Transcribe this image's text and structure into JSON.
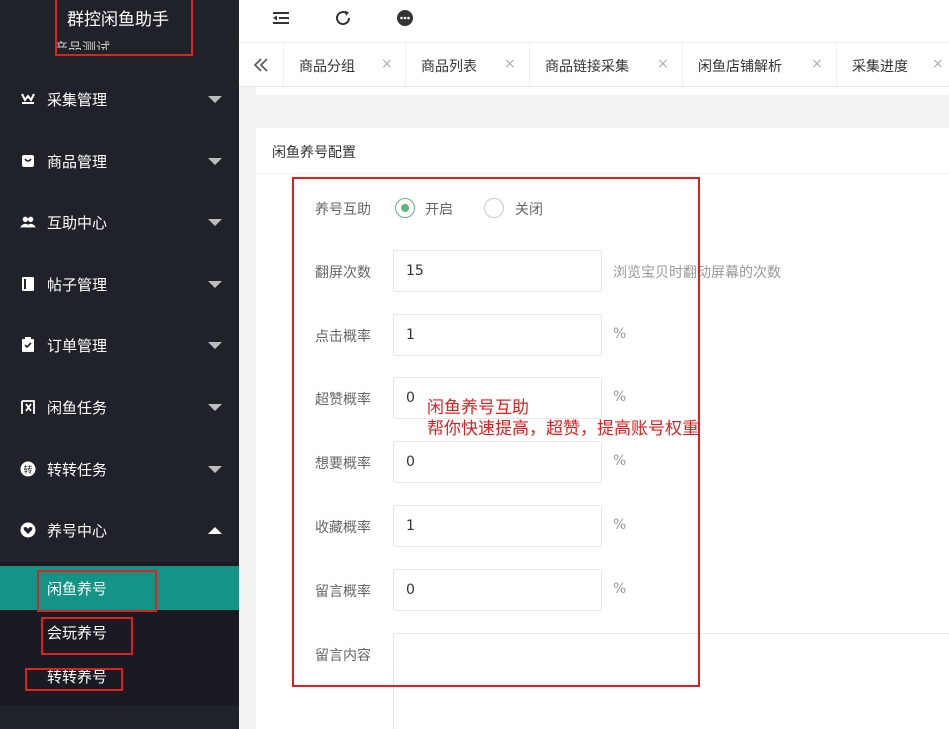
{
  "brand": {
    "title": "群控闲鱼助手",
    "peek": "产品测试"
  },
  "menu": [
    {
      "label": "采集管理",
      "icon": "collect-icon"
    },
    {
      "label": "商品管理",
      "icon": "goods-icon"
    },
    {
      "label": "互助中心",
      "icon": "users-icon"
    },
    {
      "label": "帖子管理",
      "icon": "post-icon"
    },
    {
      "label": "订单管理",
      "icon": "order-icon"
    },
    {
      "label": "闲鱼任务",
      "icon": "xianyu-icon"
    },
    {
      "label": "转转任务",
      "icon": "zhuan-icon"
    },
    {
      "label": "养号中心",
      "icon": "heart-icon"
    }
  ],
  "submenu": [
    {
      "label": "闲鱼养号"
    },
    {
      "label": "会玩养号"
    },
    {
      "label": "转转养号"
    }
  ],
  "tabs": [
    {
      "label": "商品分组"
    },
    {
      "label": "商品列表"
    },
    {
      "label": "商品链接采集"
    },
    {
      "label": "闲鱼店铺解析"
    },
    {
      "label": "采集进度"
    }
  ],
  "tab_close": "×",
  "card": {
    "title": "闲鱼养号配置"
  },
  "form": {
    "mutual": {
      "label": "养号互助",
      "on_label": "开启",
      "off_label": "关闭"
    },
    "scroll": {
      "label": "翻屏次数",
      "value": "15",
      "hint": "浏览宝贝时翻动屏幕的次数"
    },
    "click": {
      "label": "点击概率",
      "value": "1",
      "unit": "%"
    },
    "superlike": {
      "label": "超赞概率",
      "value": "0",
      "unit": "%"
    },
    "want": {
      "label": "想要概率",
      "value": "0",
      "unit": "%"
    },
    "favorite": {
      "label": "收藏概率",
      "value": "1",
      "unit": "%"
    },
    "comment": {
      "label": "留言概率",
      "value": "0",
      "unit": "%"
    },
    "content": {
      "label": "留言内容"
    }
  },
  "annotation": {
    "line1": "闲鱼养号互助",
    "line2": "帮你快速提高，超赞，提高账号权重"
  }
}
